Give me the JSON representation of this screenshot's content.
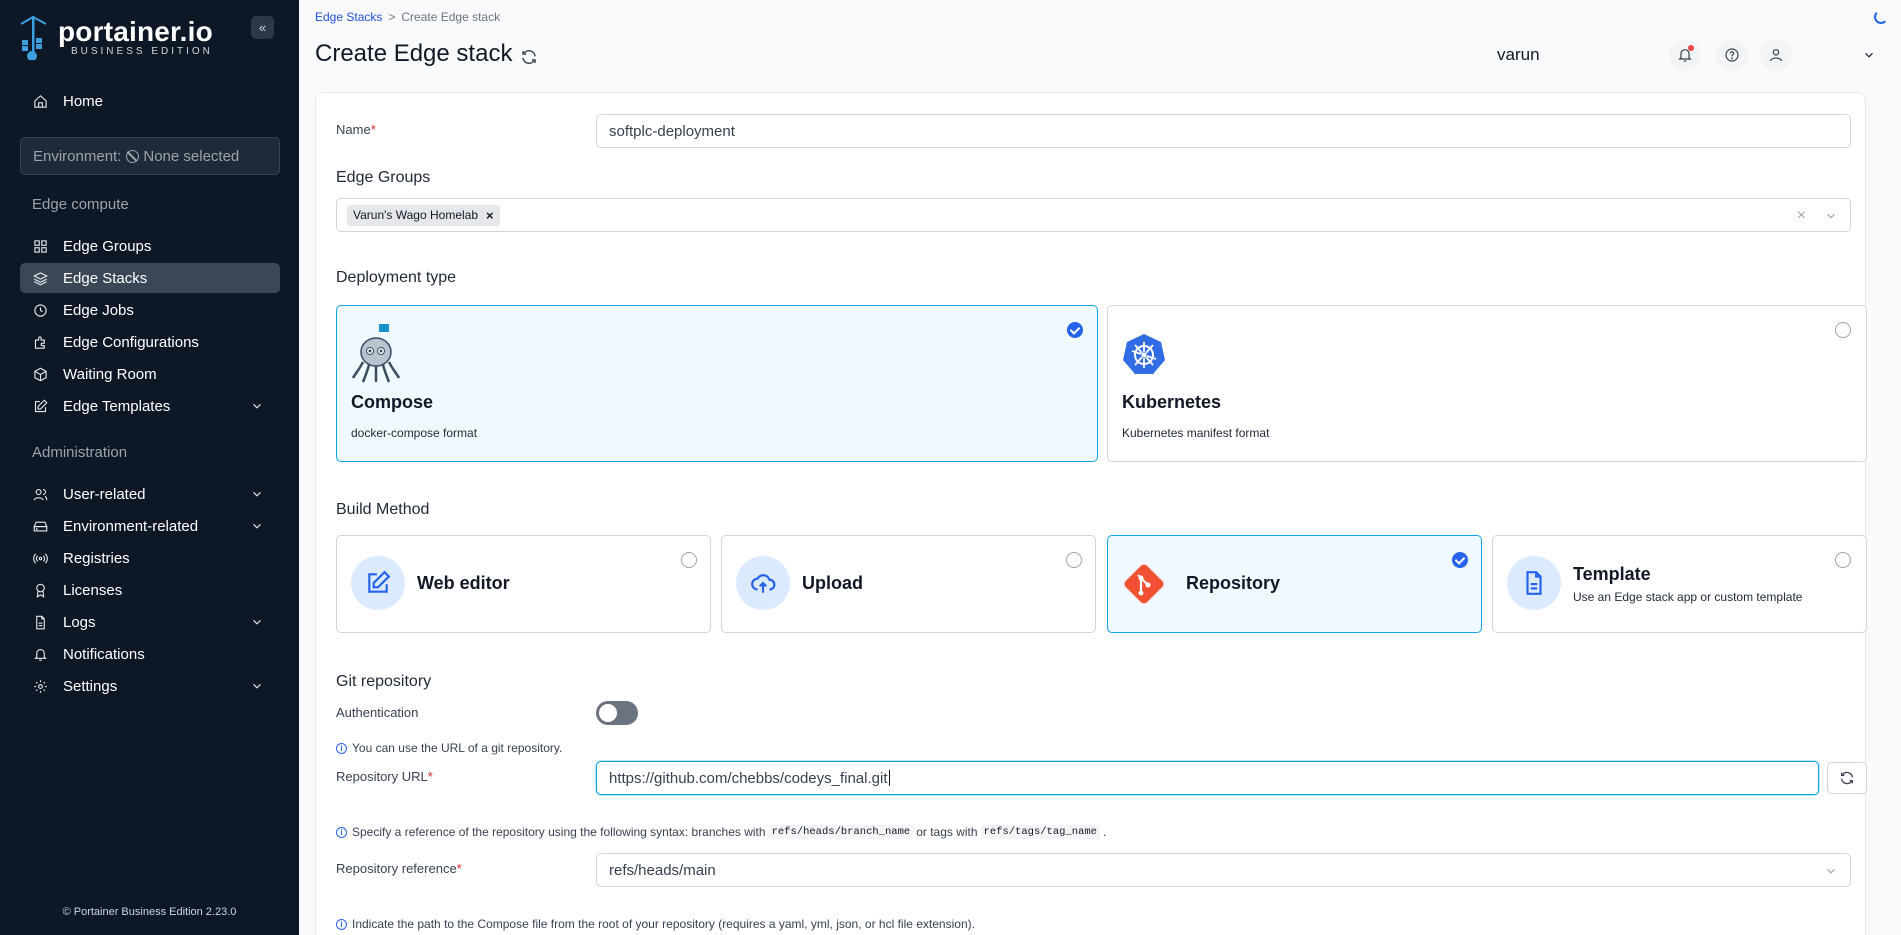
{
  "brand": {
    "name": "portainer.io",
    "edition": "BUSINESS EDITION"
  },
  "sidebar": {
    "home": "Home",
    "environment_label": "Environment:",
    "environment_value": "None selected",
    "section_edge": "Edge compute",
    "edge_items": [
      "Edge Groups",
      "Edge Stacks",
      "Edge Jobs",
      "Edge Configurations",
      "Waiting Room",
      "Edge Templates"
    ],
    "section_admin": "Administration",
    "admin_items": [
      "User-related",
      "Environment-related",
      "Registries",
      "Licenses",
      "Logs",
      "Notifications",
      "Settings"
    ],
    "version": "© Portainer Business Edition 2.23.0"
  },
  "header": {
    "breadcrumb_link": "Edge Stacks",
    "breadcrumb_sep": ">",
    "breadcrumb_current": "Create Edge stack",
    "title": "Create Edge stack",
    "username": "varun"
  },
  "form": {
    "name_label": "Name",
    "name_value": "softplc-deployment",
    "edge_groups_title": "Edge Groups",
    "edge_group_tag": "Varun's Wago Homelab",
    "deployment_title": "Deployment type",
    "deployment_options": [
      {
        "title": "Compose",
        "desc": "docker-compose format",
        "selected": true
      },
      {
        "title": "Kubernetes",
        "desc": "Kubernetes manifest format",
        "selected": false
      }
    ],
    "build_title": "Build Method",
    "build_options": [
      {
        "title": "Web editor",
        "desc": ""
      },
      {
        "title": "Upload",
        "desc": ""
      },
      {
        "title": "Repository",
        "desc": ""
      },
      {
        "title": "Template",
        "desc": "Use an Edge stack app or custom template"
      }
    ],
    "git_title": "Git repository",
    "auth_label": "Authentication",
    "git_info": "You can use the URL of a git repository.",
    "repo_url_label": "Repository URL",
    "repo_url_value": "https://github.com/chebbs/codeys_final.git",
    "ref_info_1": "Specify a reference of the repository using the following syntax: branches with",
    "ref_code_1": "refs/heads/branch_name",
    "ref_info_2": "or tags with",
    "ref_code_2": "refs/tags/tag_name",
    "ref_info_3": ".",
    "repo_ref_label": "Repository reference",
    "repo_ref_value": "refs/heads/main",
    "path_info": "Indicate the path to the Compose file from the root of your repository (requires a yaml, yml, json, or hcl file extension)."
  },
  "colors": {
    "sidebar_bg": "#0e1726",
    "accent": "#2563eb",
    "selected_border": "#0ea5e9"
  }
}
